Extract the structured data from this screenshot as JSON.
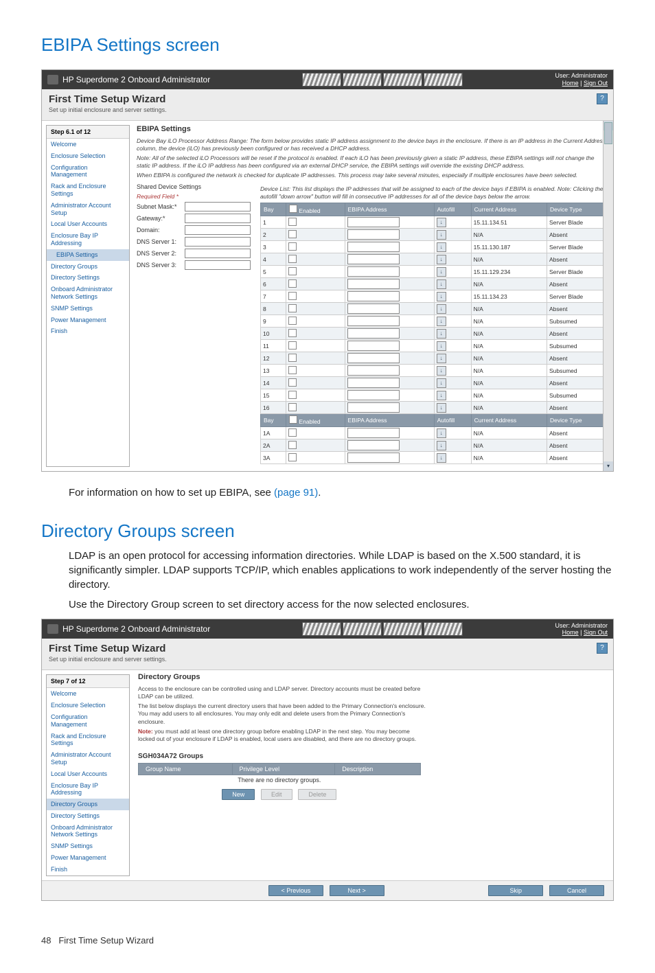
{
  "page": {
    "heading1": "EBIPA Settings screen",
    "intro_after_shot1_prefix": "For information on how to set up EBIPA, see ",
    "intro_after_shot1_link": "(page 91)",
    "intro_after_shot1_suffix": ".",
    "heading2": "Directory Groups screen",
    "dg_para1": "LDAP is an open protocol for accessing information directories. While LDAP is based on the X.500 standard, it is significantly simpler. LDAP supports TCP/IP, which enables applications to work independently of the server hosting the directory.",
    "dg_para2": "Use the Directory Group screen to set directory access for the now selected enclosures.",
    "footer_num": "48",
    "footer_text": "First Time Setup Wizard"
  },
  "shot_header": {
    "app_title": "HP Superdome 2 Onboard Administrator",
    "user_label": "User: Administrator",
    "home": "Home",
    "signout": "Sign Out"
  },
  "wizard": {
    "title": "First Time Setup Wizard",
    "subtitle": "Set up initial enclosure and server settings."
  },
  "shot1": {
    "step": "Step 6.1 of 12",
    "sidebar": [
      "Welcome",
      "Enclosure Selection",
      "Configuration Management",
      "Rack and Enclosure Settings",
      "Administrator Account Setup",
      "Local User Accounts",
      "Enclosure Bay IP Addressing",
      "EBIPA Settings",
      "Directory Groups",
      "Directory Settings",
      "Onboard Administrator Network Settings",
      "SNMP Settings",
      "Power Management",
      "Finish"
    ],
    "sidebar_selected": "EBIPA Settings",
    "section_title": "EBIPA Settings",
    "p1": "Device Bay iLO Processor Address Range: The form below provides static IP address assignment to the device bays in the enclosure. If there is an IP address in the Current Address column, the device (iLO) has previously been configured or has received a DHCP address.",
    "p2": "Note:  All of the selected iLO Processors will be reset if the protocol is enabled. If each iLO has been previously given a static IP address, these EBIPA settings will not change the static IP address. If the iLO IP address has been configured via an external DHCP service, the EBIPA settings will override the existing DHCP address.",
    "p3": "When EBIPA is configured the network is checked for duplicate IP addresses. This process may take several minutes, especially if multiple enclosures have been selected.",
    "shared_title": "Shared Device Settings",
    "required": "Required Field *",
    "fields": {
      "subnet": "Subnet Mask:*",
      "gateway": "Gateway:*",
      "domain": "Domain:",
      "dns1": "DNS Server 1:",
      "dns2": "DNS Server 2:",
      "dns3": "DNS Server 3:"
    },
    "list_desc": "Device List: This list displays the IP addresses that will be assigned to each of the device bays if EBIPA is enabled.  Note: Clicking the autofill \"down arrow\" button will fill in consecutive IP addresses for all of the device bays below the arrow.",
    "cols": [
      "Bay",
      "Enabled",
      "EBIPA Address",
      "Autofill",
      "Current Address",
      "Device Type"
    ],
    "rows": [
      {
        "bay": "1",
        "cur": "15.11.134.51",
        "type": "Server Blade"
      },
      {
        "bay": "2",
        "cur": "N/A",
        "type": "Absent"
      },
      {
        "bay": "3",
        "cur": "15.11.130.187",
        "type": "Server Blade"
      },
      {
        "bay": "4",
        "cur": "N/A",
        "type": "Absent"
      },
      {
        "bay": "5",
        "cur": "15.11.129.234",
        "type": "Server Blade"
      },
      {
        "bay": "6",
        "cur": "N/A",
        "type": "Absent"
      },
      {
        "bay": "7",
        "cur": "15.11.134.23",
        "type": "Server Blade"
      },
      {
        "bay": "8",
        "cur": "N/A",
        "type": "Absent"
      },
      {
        "bay": "9",
        "cur": "N/A",
        "type": "Subsumed"
      },
      {
        "bay": "10",
        "cur": "N/A",
        "type": "Absent"
      },
      {
        "bay": "11",
        "cur": "N/A",
        "type": "Subsumed"
      },
      {
        "bay": "12",
        "cur": "N/A",
        "type": "Absent"
      },
      {
        "bay": "13",
        "cur": "N/A",
        "type": "Subsumed"
      },
      {
        "bay": "14",
        "cur": "N/A",
        "type": "Absent"
      },
      {
        "bay": "15",
        "cur": "N/A",
        "type": "Subsumed"
      },
      {
        "bay": "16",
        "cur": "N/A",
        "type": "Absent"
      }
    ],
    "rows2": [
      {
        "bay": "1A",
        "cur": "N/A",
        "type": "Absent"
      },
      {
        "bay": "2A",
        "cur": "N/A",
        "type": "Absent"
      },
      {
        "bay": "3A",
        "cur": "N/A",
        "type": "Absent"
      }
    ]
  },
  "shot2": {
    "step": "Step 7 of 12",
    "sidebar": [
      "Welcome",
      "Enclosure Selection",
      "Configuration Management",
      "Rack and Enclosure Settings",
      "Administrator Account Setup",
      "Local User Accounts",
      "Enclosure Bay IP Addressing",
      "Directory Groups",
      "Directory Settings",
      "Onboard Administrator Network Settings",
      "SNMP Settings",
      "Power Management",
      "Finish"
    ],
    "sidebar_selected": "Directory Groups",
    "section_title": "Directory Groups",
    "p1": "Access to the enclosure can be controlled using and LDAP server. Directory accounts must be created before LDAP can be utilized.",
    "p2": "The list below displays the current directory users that have been added to the Primary Connection's enclosure. You may add users to all enclosures. You may only edit and delete users from the Primary Connection's enclosure.",
    "p3_label": "Note:",
    "p3": " you must add at least one directory group before enabling LDAP in the next step. You may become locked out of your enclosure if LDAP is enabled, local users are disabled, and there are no directory groups.",
    "groups_title": "SGH034A72 Groups",
    "cols": [
      "Group Name",
      "Privilege Level",
      "Description"
    ],
    "empty": "There are no directory groups.",
    "btn_new": "New",
    "btn_edit": "Edit",
    "btn_del": "Delete",
    "nav_prev": "< Previous",
    "nav_next": "Next >",
    "nav_skip": "Skip",
    "nav_cancel": "Cancel"
  }
}
